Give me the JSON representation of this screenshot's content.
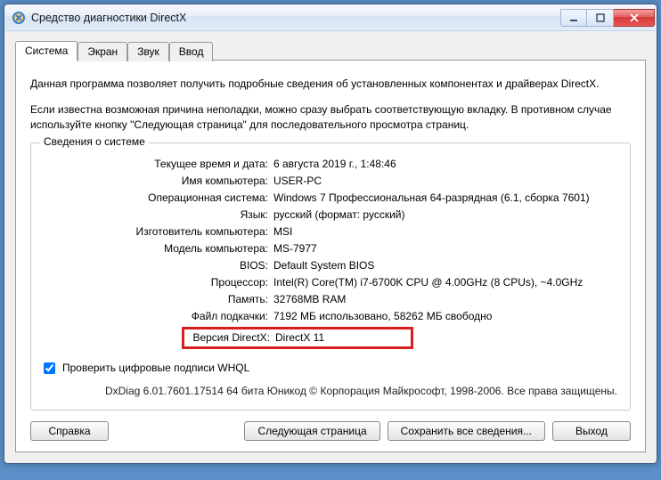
{
  "window": {
    "title": "Средство диагностики DirectX"
  },
  "tabs": {
    "system": "Система",
    "display": "Экран",
    "sound": "Звук",
    "input": "Ввод"
  },
  "intro": {
    "p1": "Данная программа позволяет получить подробные сведения об установленных компонентах и драйверах DirectX.",
    "p2": "Если известна возможная причина неполадки, можно сразу выбрать соответствующую вкладку. В противном случае используйте кнопку \"Следующая страница\" для последовательного просмотра страниц."
  },
  "fieldset_legend": "Сведения о системе",
  "labels": {
    "datetime": "Текущее время и дата:",
    "computer": "Имя компьютера:",
    "os": "Операционная система:",
    "lang": "Язык:",
    "manuf": "Изготовитель компьютера:",
    "model": "Модель компьютера:",
    "bios": "BIOS:",
    "cpu": "Процессор:",
    "mem": "Память:",
    "page": "Файл подкачки:",
    "dxver": "Версия DirectX:"
  },
  "values": {
    "datetime": "6 августа 2019 г., 1:48:46",
    "computer": "USER-PC",
    "os": "Windows 7 Профессиональная 64-разрядная (6.1, сборка 7601)",
    "lang": "русский (формат: русский)",
    "manuf": "MSI",
    "model": "MS-7977",
    "bios": "Default System BIOS",
    "cpu": "Intel(R) Core(TM) i7-6700K CPU @ 4.00GHz (8 CPUs), ~4.0GHz",
    "mem": "32768MB RAM",
    "page": "7192 МБ использовано, 58262 МБ свободно",
    "dxver": "DirectX 11"
  },
  "whql_label": "Проверить цифровые подписи WHQL",
  "footer": "DxDiag 6.01.7601.17514 64 бита Юникод   © Корпорация Майкрософт, 1998-2006.  Все права защищены.",
  "buttons": {
    "help": "Справка",
    "next": "Следующая страница",
    "save": "Сохранить все сведения...",
    "exit": "Выход"
  }
}
